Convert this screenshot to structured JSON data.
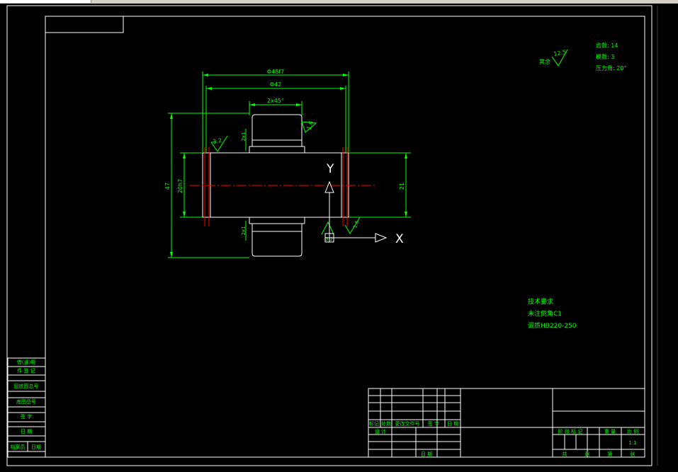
{
  "params": {
    "teeth": "齿数: 14",
    "module": "模数: 3",
    "pressure_angle": "压力角: 20°"
  },
  "roughness": {
    "rest_label": "其余",
    "rest_value": "12.5",
    "r_left": "3.2",
    "r_tooth": "1.6",
    "r_bottom1": "3.2",
    "r_bottom2": "1.6"
  },
  "dims": {
    "overall_width": "Φ48f7",
    "face_width": "Φ42",
    "tooth_dim": "2x45°",
    "left_height": "47",
    "bore_dia": "20h7",
    "right_height": "21",
    "chamfer_top": "2x1",
    "chamfer_bottom": "2x1"
  },
  "axes": {
    "y": "Y",
    "x": "X"
  },
  "tech": {
    "title": "技术要求",
    "line1": "未注倒角C1",
    "line2": "调质HB220-250"
  },
  "left_table": [
    "借(通)用",
    "件 登 记",
    "旧底图总号",
    "底图总号",
    "签 字",
    "日 期",
    "档案员",
    "日期"
  ],
  "title_block": {
    "row_labels": [
      "标记",
      "处数",
      "更改文件号",
      "签 字",
      "日 期"
    ],
    "design": "设 计",
    "date": "日 期",
    "stage": "阶 段 标 记",
    "weight": "重 量",
    "ratio_label": "比 例",
    "ratio": "1:1",
    "sheets": "共",
    "sheet": "张",
    "sheet_no": "第",
    "sheet2": "张"
  }
}
